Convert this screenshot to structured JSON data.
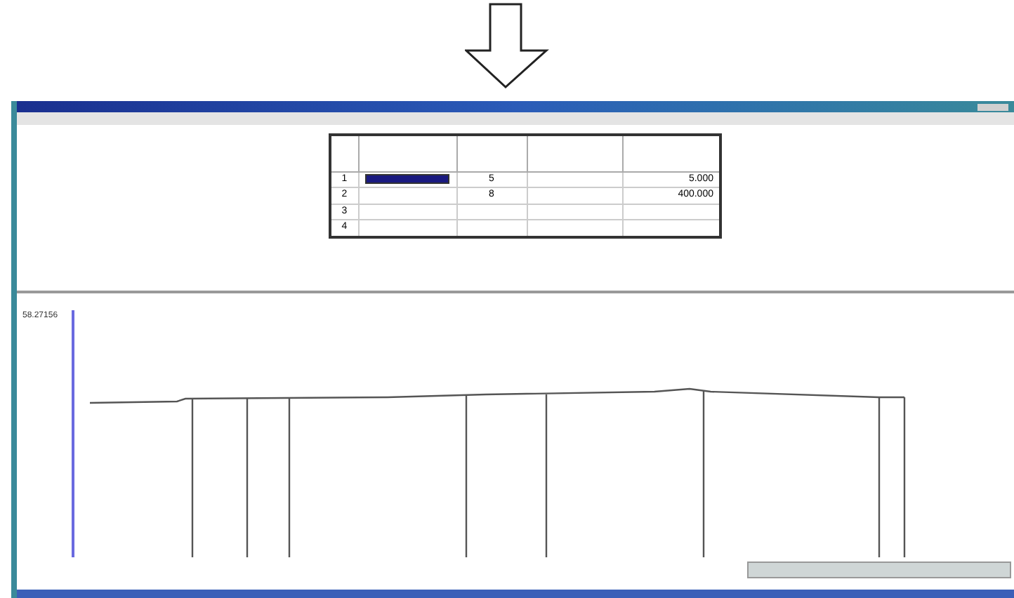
{
  "grid": {
    "rows": [
      {
        "number": "1",
        "column_2": "5",
        "column_4": "5.000",
        "selected": true
      },
      {
        "number": "2",
        "column_2": "8",
        "column_4": "400.000",
        "selected": false
      },
      {
        "number": "3",
        "selected": false
      },
      {
        "number": "4",
        "selected": false
      }
    ]
  },
  "chart": {
    "start_label": "58.27156"
  }
}
